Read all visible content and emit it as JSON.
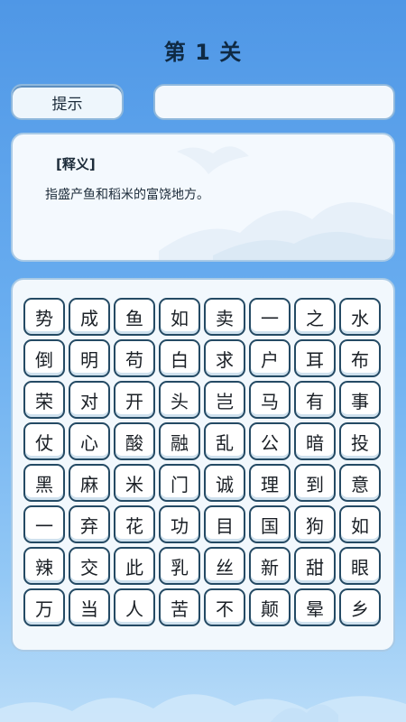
{
  "level_title": "第 1 关",
  "hint_label": "提示",
  "definition": {
    "label": "[释义]",
    "text": "指盛产鱼和稻米的富饶地方。"
  },
  "grid": [
    [
      "势",
      "成",
      "鱼",
      "如",
      "卖",
      "一",
      "之",
      "水"
    ],
    [
      "倒",
      "明",
      "苟",
      "白",
      "求",
      "户",
      "耳",
      "布"
    ],
    [
      "荣",
      "对",
      "开",
      "头",
      "岂",
      "马",
      "有",
      "事"
    ],
    [
      "仗",
      "心",
      "酸",
      "融",
      "乱",
      "公",
      "暗",
      "投"
    ],
    [
      "黑",
      "麻",
      "米",
      "门",
      "诚",
      "理",
      "到",
      "意"
    ],
    [
      "一",
      "弃",
      "花",
      "功",
      "目",
      "国",
      "狗",
      "如"
    ],
    [
      "辣",
      "交",
      "此",
      "乳",
      "丝",
      "新",
      "甜",
      "眼"
    ],
    [
      "万",
      "当",
      "人",
      "苦",
      "不",
      "颠",
      "晕",
      "乡"
    ]
  ]
}
